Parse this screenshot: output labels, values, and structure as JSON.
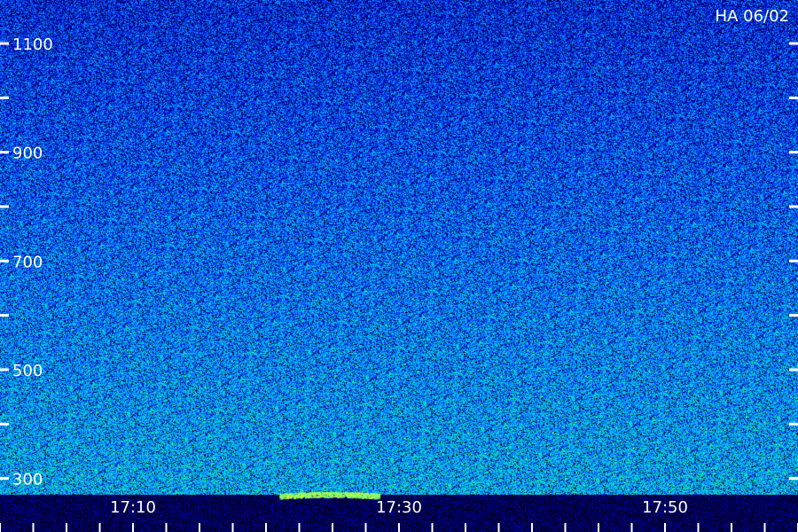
{
  "header": {
    "station_label": "HA 06/02"
  },
  "chart_data": {
    "type": "heatmap",
    "title": "",
    "xlabel": "",
    "ylabel": "",
    "x_tick_labels": [
      "17:10",
      "17:30",
      "17:50"
    ],
    "x_tick_values_min": [
      70,
      90,
      110
    ],
    "y_tick_labels": [
      "300",
      "500",
      "700",
      "900",
      "1100"
    ],
    "y_tick_values": [
      300,
      500,
      700,
      900,
      1100
    ],
    "y_minor_ticks": [
      400,
      600,
      800,
      1000
    ],
    "xlim_min": [
      60,
      120
    ],
    "ylim": [
      270,
      1180
    ],
    "colormap": [
      "#000020",
      "#0000b0",
      "#1040ff",
      "#00c0ff",
      "#10e8a0",
      "#a0ff40"
    ],
    "grid": false,
    "features": [
      {
        "name": "burst",
        "t_start": 81,
        "t_end": 88.5,
        "freq": 290,
        "intensity": 0.95
      }
    ]
  }
}
